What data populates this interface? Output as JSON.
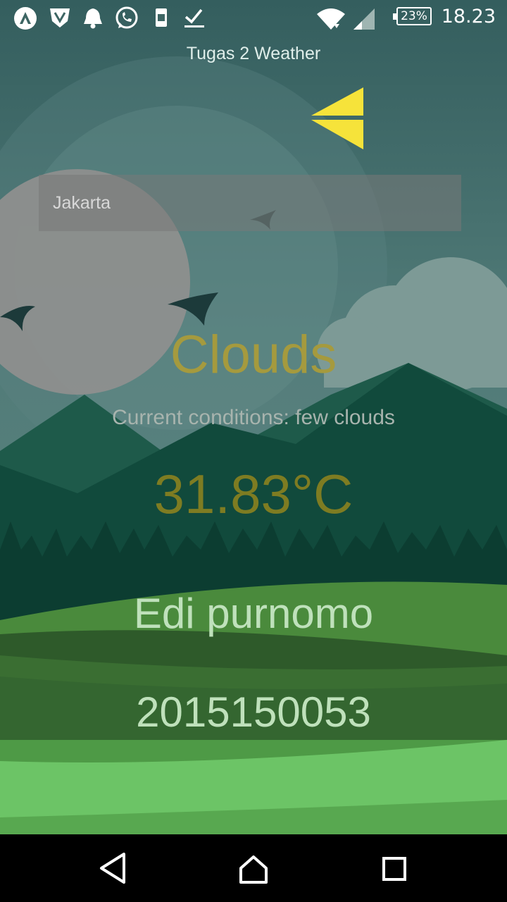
{
  "status_bar": {
    "time": "18.23",
    "battery": "23%",
    "icons": [
      "app-logo-icon",
      "shield-icon",
      "bell-icon",
      "whatsapp-icon",
      "phone-charging-icon",
      "check-icon",
      "wifi-icon",
      "signal-icon",
      "battery-icon"
    ]
  },
  "app": {
    "title": "Tugas 2 Weather",
    "back_icon": "back-arrow-icon"
  },
  "search": {
    "value": "Jakarta",
    "placeholder": ""
  },
  "weather": {
    "main": "Clouds",
    "description": "Current conditions: few clouds",
    "temperature": "31.83°C"
  },
  "student": {
    "name": "Edi purnomo",
    "id": "2015150053"
  },
  "nav_bar": {
    "buttons": [
      "back-icon",
      "home-icon",
      "recents-icon"
    ]
  },
  "colors": {
    "sky": "#4f7a76",
    "mountain": "#0f4a3c",
    "grass": "#3f7a35",
    "accent_arrow": "#f6e33a"
  }
}
